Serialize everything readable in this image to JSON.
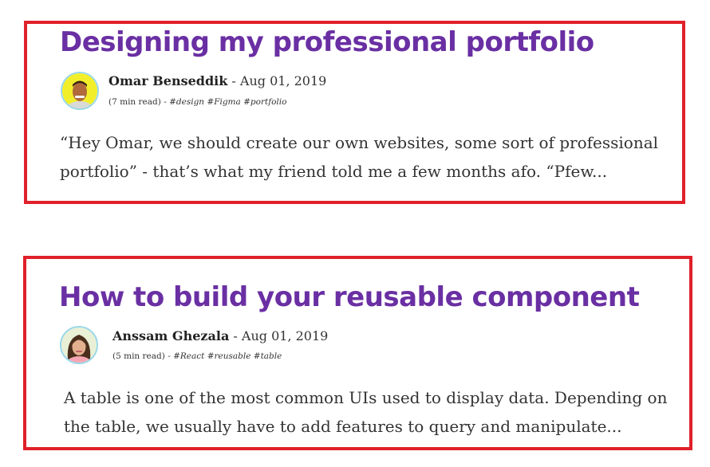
{
  "posts": [
    {
      "title": "Designing my professional portfolio",
      "author": "Omar Benseddik",
      "separator": "-",
      "date": "Aug 01, 2019",
      "read_time": "(7 min read)",
      "dash": "-",
      "tags": "#design #Figma #portfolio",
      "excerpt": "“Hey Omar, we should create our own websites, some sort of professional portfolio” - that’s what my friend told me a few months afo. “Pfew...",
      "avatar_icon": "avatar-man",
      "avatar_bg": "#f2ef2a"
    },
    {
      "title": "How to build your reusable component",
      "author": "Anssam Ghezala",
      "separator": "-",
      "date": "Aug 01, 2019",
      "read_time": "(5 min read)",
      "dash": "-",
      "tags": "#React #reusable #table",
      "excerpt": "A table is one of the most common UIs used to display data. Depending on the table, we usually have to add features to query and manipulate...",
      "avatar_icon": "avatar-woman",
      "avatar_bg": "#e9f0d6"
    }
  ],
  "colors": {
    "card_border": "#e0202a",
    "title": "#6a2fa3",
    "avatar_ring": "#9ad8ea"
  }
}
